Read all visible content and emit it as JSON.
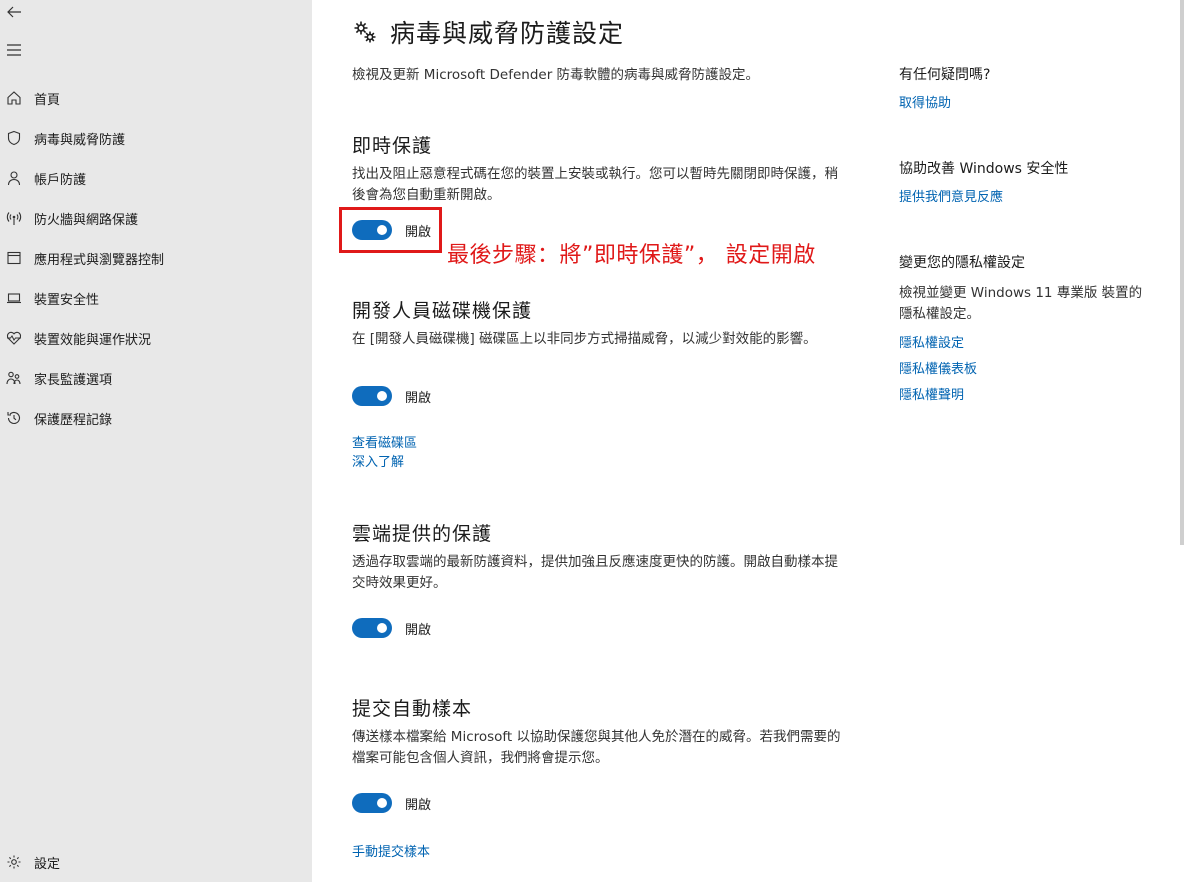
{
  "sidebar": {
    "items": [
      {
        "label": "首頁",
        "icon": "home-icon"
      },
      {
        "label": "病毒與威脅防護",
        "icon": "shield-icon"
      },
      {
        "label": "帳戶防護",
        "icon": "person-icon"
      },
      {
        "label": "防火牆與網路保護",
        "icon": "wifi-antenna-icon"
      },
      {
        "label": "應用程式與瀏覽器控制",
        "icon": "app-window-icon"
      },
      {
        "label": "裝置安全性",
        "icon": "laptop-icon"
      },
      {
        "label": "裝置效能與運作狀況",
        "icon": "heart-pulse-icon"
      },
      {
        "label": "家長監護選項",
        "icon": "family-icon"
      },
      {
        "label": "保護歷程記錄",
        "icon": "history-icon"
      }
    ],
    "settings_label": "設定"
  },
  "main": {
    "title": "病毒與威脅防護設定",
    "description": "檢視及更新 Microsoft Defender 防毒軟體的病毒與威脅防護設定。",
    "sections": [
      {
        "title": "即時保護",
        "description": "找出及阻止惡意程式碼在您的裝置上安裝或執行。您可以暫時先關閉即時保護，稍後會為您自動重新開啟。",
        "toggle_label": "開啟",
        "toggle_on": true
      },
      {
        "title": "開發人員磁碟機保護",
        "description": "在 [開發人員磁碟機] 磁碟區上以非同步方式掃描威脅，以減少對效能的影響。",
        "toggle_label": "開啟",
        "toggle_on": true,
        "links": [
          "查看磁碟區",
          "深入了解"
        ]
      },
      {
        "title": "雲端提供的保護",
        "description": "透過存取雲端的最新防護資料，提供加強且反應速度更快的防護。開啟自動樣本提交時效果更好。",
        "toggle_label": "開啟",
        "toggle_on": true
      },
      {
        "title": "提交自動樣本",
        "description": "傳送樣本檔案給 Microsoft 以協助保護您與其他人免於潛在的威脅。若我們需要的檔案可能包含個人資訊，我們將會提示您。",
        "toggle_label": "開啟",
        "toggle_on": true,
        "links": [
          "手動提交樣本"
        ]
      }
    ],
    "annotation": "最後步驟：將”即時保護”，  設定開啟"
  },
  "right_column": {
    "help_title": "有任何疑問嗎?",
    "help_link": "取得協助",
    "improve_title": "協助改善 Windows 安全性",
    "improve_link": "提供我們意見反應",
    "privacy_title": "變更您的隱私權設定",
    "privacy_desc": "檢視並變更 Windows 11 專業版 裝置的隱私權設定。",
    "privacy_links": [
      "隱私權設定",
      "隱私權儀表板",
      "隱私權聲明"
    ]
  },
  "colors": {
    "sidebar_bg": "#e8e8e8",
    "accent": "#0f6cbd",
    "link": "#0063b1",
    "annotation": "#e01919"
  }
}
